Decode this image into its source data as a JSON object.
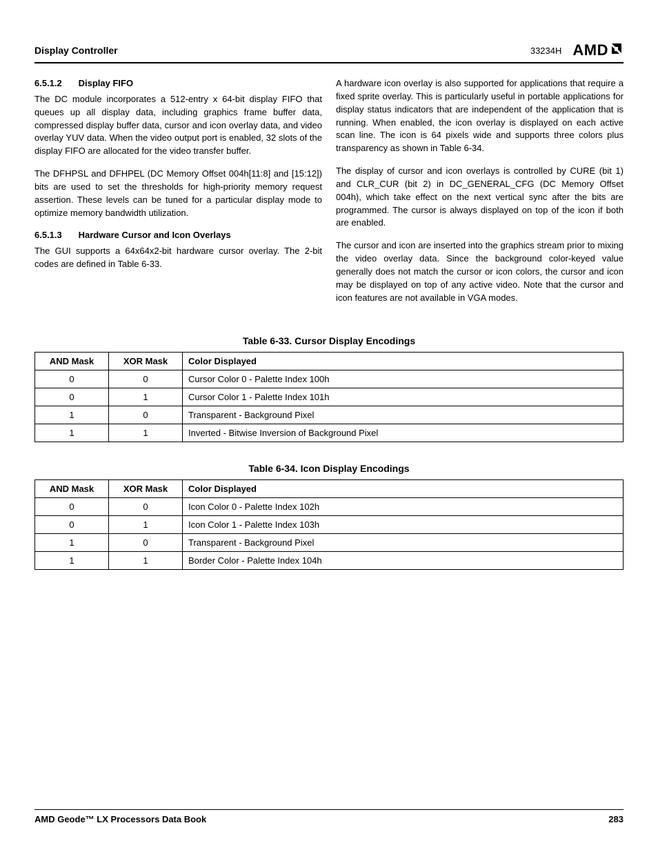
{
  "header": {
    "section": "Display Controller",
    "doc_code": "33234H",
    "logo_text": "AMD"
  },
  "left_col": {
    "h1_num": "6.5.1.2",
    "h1_title": "Display FIFO",
    "p1": "The DC module incorporates a 512-entry x 64-bit display FIFO that queues up all display data, including graphics frame buffer data, compressed display buffer data, cursor and icon overlay data, and video overlay YUV data. When the video output port is enabled, 32 slots of the display FIFO are allocated for the video transfer buffer.",
    "p2": "The DFHPSL and DFHPEL (DC Memory Offset 004h[11:8] and [15:12]) bits are used to set the thresholds for high-priority memory request assertion. These levels can be tuned for a particular display mode to optimize memory bandwidth utilization.",
    "h2_num": "6.5.1.3",
    "h2_title": "Hardware Cursor and Icon Overlays",
    "p3": "The GUI supports a 64x64x2-bit hardware cursor overlay. The 2-bit codes are defined in Table 6-33."
  },
  "right_col": {
    "p1": "A hardware icon overlay is also supported for applications that require a fixed sprite overlay. This is particularly useful in portable applications for display status indicators that are independent of the application that is running. When enabled, the icon overlay is displayed on each active scan line. The icon is 64 pixels wide and supports three colors plus transparency as shown in Table 6-34.",
    "p2": "The display of cursor and icon overlays is controlled by CURE (bit 1) and CLR_CUR (bit 2) in DC_GENERAL_CFG (DC Memory Offset 004h), which take effect on the next vertical sync after the bits are programmed. The cursor is always displayed on top of the icon if both are enabled.",
    "p3": "The cursor and icon are inserted into the graphics stream prior to mixing the video overlay data. Since the background color-keyed value generally does not match the cursor or icon colors, the cursor and icon may be displayed on top of any active video. Note that the cursor and icon features are not available in VGA modes."
  },
  "table1": {
    "caption": "Table 6-33.  Cursor Display Encodings",
    "headers": {
      "c1": "AND Mask",
      "c2": "XOR Mask",
      "c3": "Color Displayed"
    },
    "rows": [
      {
        "and": "0",
        "xor": "0",
        "desc": "Cursor Color 0 - Palette Index 100h"
      },
      {
        "and": "0",
        "xor": "1",
        "desc": "Cursor Color 1 - Palette Index 101h"
      },
      {
        "and": "1",
        "xor": "0",
        "desc": "Transparent - Background Pixel"
      },
      {
        "and": "1",
        "xor": "1",
        "desc": "Inverted - Bitwise Inversion of Background Pixel"
      }
    ]
  },
  "table2": {
    "caption": "Table 6-34.  Icon Display Encodings",
    "headers": {
      "c1": "AND Mask",
      "c2": "XOR Mask",
      "c3": "Color Displayed"
    },
    "rows": [
      {
        "and": "0",
        "xor": "0",
        "desc": "Icon Color 0 - Palette Index 102h"
      },
      {
        "and": "0",
        "xor": "1",
        "desc": "Icon Color 1 - Palette Index 103h"
      },
      {
        "and": "1",
        "xor": "0",
        "desc": "Transparent - Background Pixel"
      },
      {
        "and": "1",
        "xor": "1",
        "desc": "Border Color - Palette Index 104h"
      }
    ]
  },
  "footer": {
    "title": "AMD Geode™ LX Processors Data Book",
    "page": "283"
  }
}
